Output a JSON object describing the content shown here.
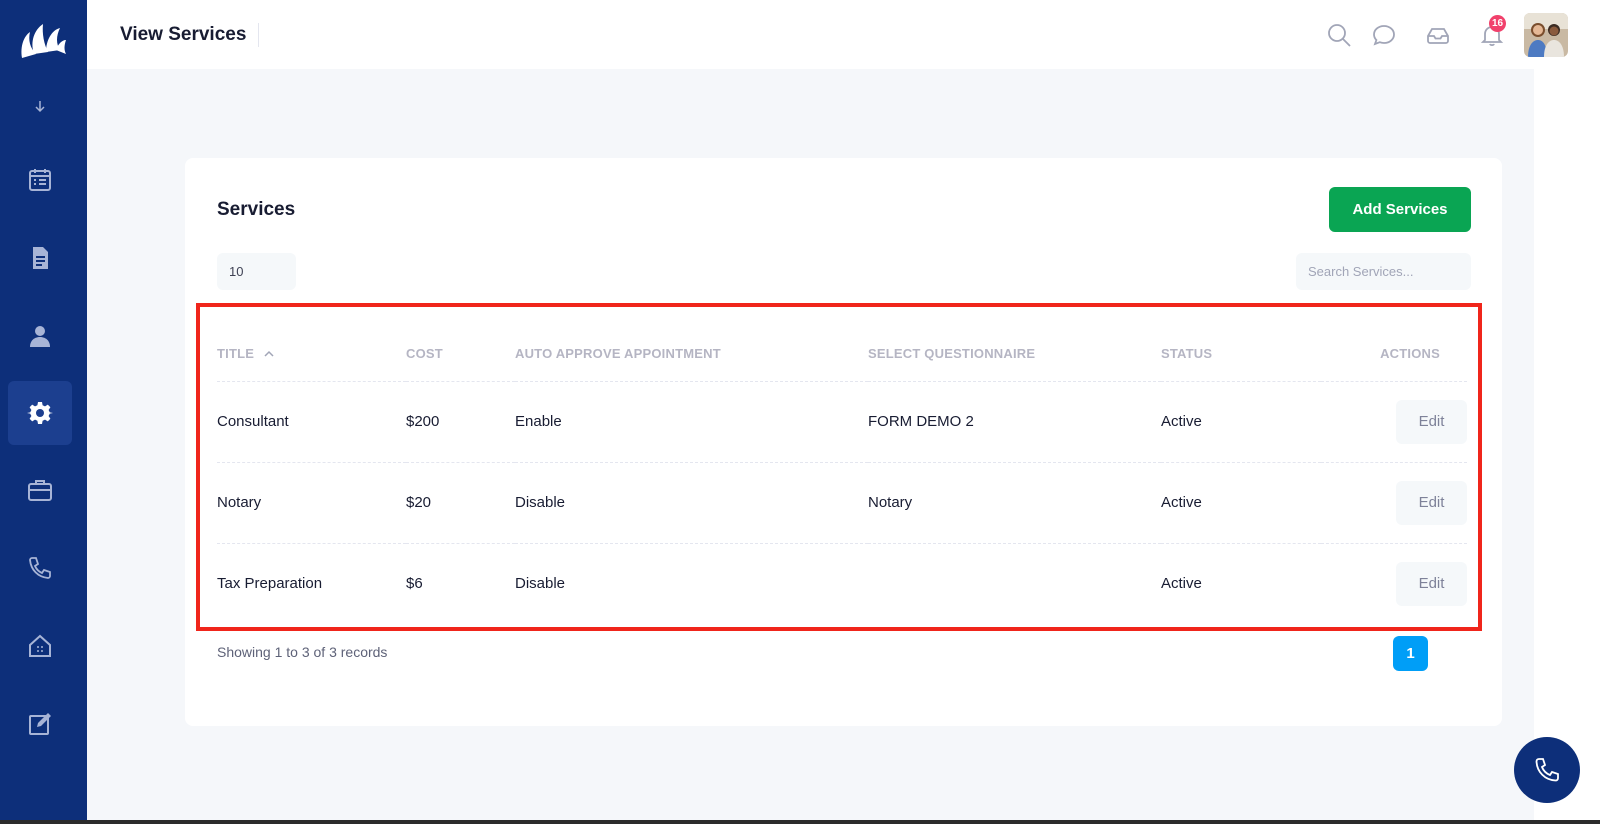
{
  "header": {
    "title": "View Services",
    "notification_count": "16"
  },
  "sidebar": {
    "items": [
      {
        "icon": "calendar-icon",
        "active": false
      },
      {
        "icon": "document-icon",
        "active": false
      },
      {
        "icon": "user-icon",
        "active": false
      },
      {
        "icon": "settings-icon",
        "active": true
      },
      {
        "icon": "briefcase-icon",
        "active": false
      },
      {
        "icon": "phone-icon",
        "active": false
      },
      {
        "icon": "house-icon",
        "active": false
      },
      {
        "icon": "edit-icon",
        "active": false
      }
    ]
  },
  "card": {
    "title": "Services",
    "add_button": "Add Services",
    "page_size": "10",
    "search_placeholder": "Search Services..."
  },
  "table": {
    "columns": [
      "Title",
      "Cost",
      "Auto Approve Appointment",
      "Select Questionnaire",
      "Status",
      "Actions"
    ],
    "rows": [
      {
        "title": "Consultant",
        "cost": "$200",
        "auto_approve": "Enable",
        "questionnaire": "FORM DEMO 2",
        "status": "Active",
        "action": "Edit"
      },
      {
        "title": "Notary",
        "cost": "$20",
        "auto_approve": "Disable",
        "questionnaire": "Notary",
        "status": "Active",
        "action": "Edit"
      },
      {
        "title": "Tax Preparation",
        "cost": "$6",
        "auto_approve": "Disable",
        "questionnaire": "",
        "status": "Active",
        "action": "Edit"
      }
    ]
  },
  "footer": {
    "records_text": "Showing 1 to 3 of 3 records",
    "current_page": "1"
  },
  "colors": {
    "sidebar": "#0d2f7a",
    "primary_button": "#0aa553",
    "pagination": "#009ef7",
    "highlight_border": "#f0251b"
  }
}
